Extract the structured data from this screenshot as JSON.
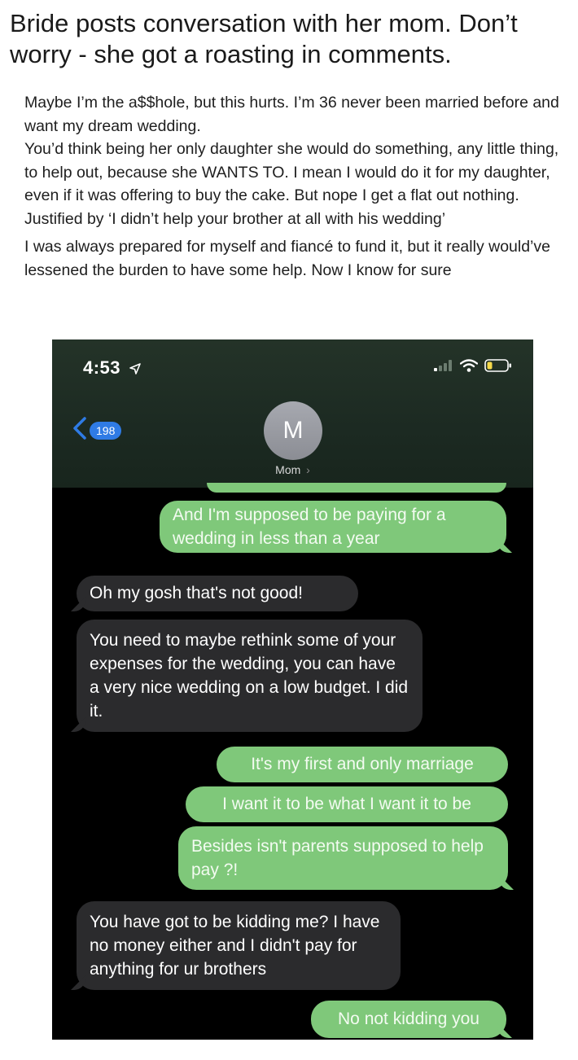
{
  "headline": "Bride posts conversation with her mom. Don’t worry - she got a roasting in comments.",
  "post": {
    "paragraph1": "Maybe I’m the a$$hole, but this hurts. I’m 36 never been married before and want my dream wedding.",
    "paragraph2": "You’d think being her only daughter she would do something, any little thing, to help out, because she WANTS TO. I mean I would do it for my daughter, even if it was offering to buy the cake. But nope I get a flat out nothing. Justified by ‘I didn’t help your brother at all with his wedding’",
    "paragraph3": "I was always prepared for myself and fiancé to fund it, but it really would’ve lessened the burden to have some help. Now I know for sure"
  },
  "phone": {
    "status": {
      "time": "4:53",
      "location_icon": "location-arrow-icon",
      "signal_icon": "cellular-signal-icon",
      "wifi_icon": "wifi-icon",
      "battery_icon": "battery-icon"
    },
    "header": {
      "back_badge": "198",
      "avatar_initial": "M",
      "contact_name": "Mom",
      "chevron": "›"
    },
    "colors": {
      "sent_bubble": "#7fc87a",
      "received_bubble": "#2b2b2d",
      "badge": "#2f7be5"
    },
    "messages": [
      {
        "from": "me",
        "text": "And I'm supposed to be paying for a wedding in less than a year"
      },
      {
        "from": "them",
        "text": "Oh my gosh that's not good!"
      },
      {
        "from": "them",
        "text": "You need to maybe rethink some of your expenses for the wedding, you can have a very nice wedding on a low budget. I did it."
      },
      {
        "from": "me",
        "text": "It's my first and only marriage"
      },
      {
        "from": "me",
        "text": "I want it to be what I want it to be"
      },
      {
        "from": "me",
        "text": "Besides isn't parents supposed to help pay ?!"
      },
      {
        "from": "them",
        "text": "You have got to be kidding me? I have no money either and I didn't pay for anything for ur brothers"
      },
      {
        "from": "me",
        "text": "No not kidding you"
      }
    ]
  }
}
